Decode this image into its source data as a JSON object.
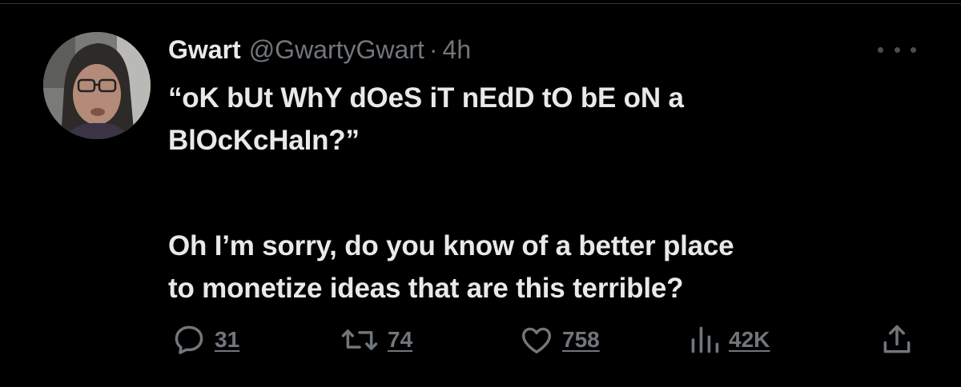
{
  "tweet": {
    "display_name": "Gwart",
    "handle": "@GwartyGwart",
    "separator": "·",
    "time": "4h",
    "text_line_1": "“oK bUt WhY dOeS iT nEdD tO bE oN a",
    "text_line_2": "BlOcKcHaIn?”",
    "text_line_3": "Oh I’m sorry, do you know of a better place",
    "text_line_4": "to monetize ideas that are this terrible?"
  },
  "actions": {
    "replies": "31",
    "retweets": "74",
    "likes": "758",
    "views": "42K"
  },
  "colors": {
    "background": "#000000",
    "text_primary": "#e7e9ea",
    "text_secondary": "#71767b",
    "divider": "#2f3336"
  },
  "icons": {
    "reply": "speech-bubble-icon",
    "retweet": "retweet-arrows-icon",
    "like": "heart-icon",
    "views": "bar-chart-icon",
    "share": "share-upload-icon",
    "more": "more-dots-icon"
  }
}
